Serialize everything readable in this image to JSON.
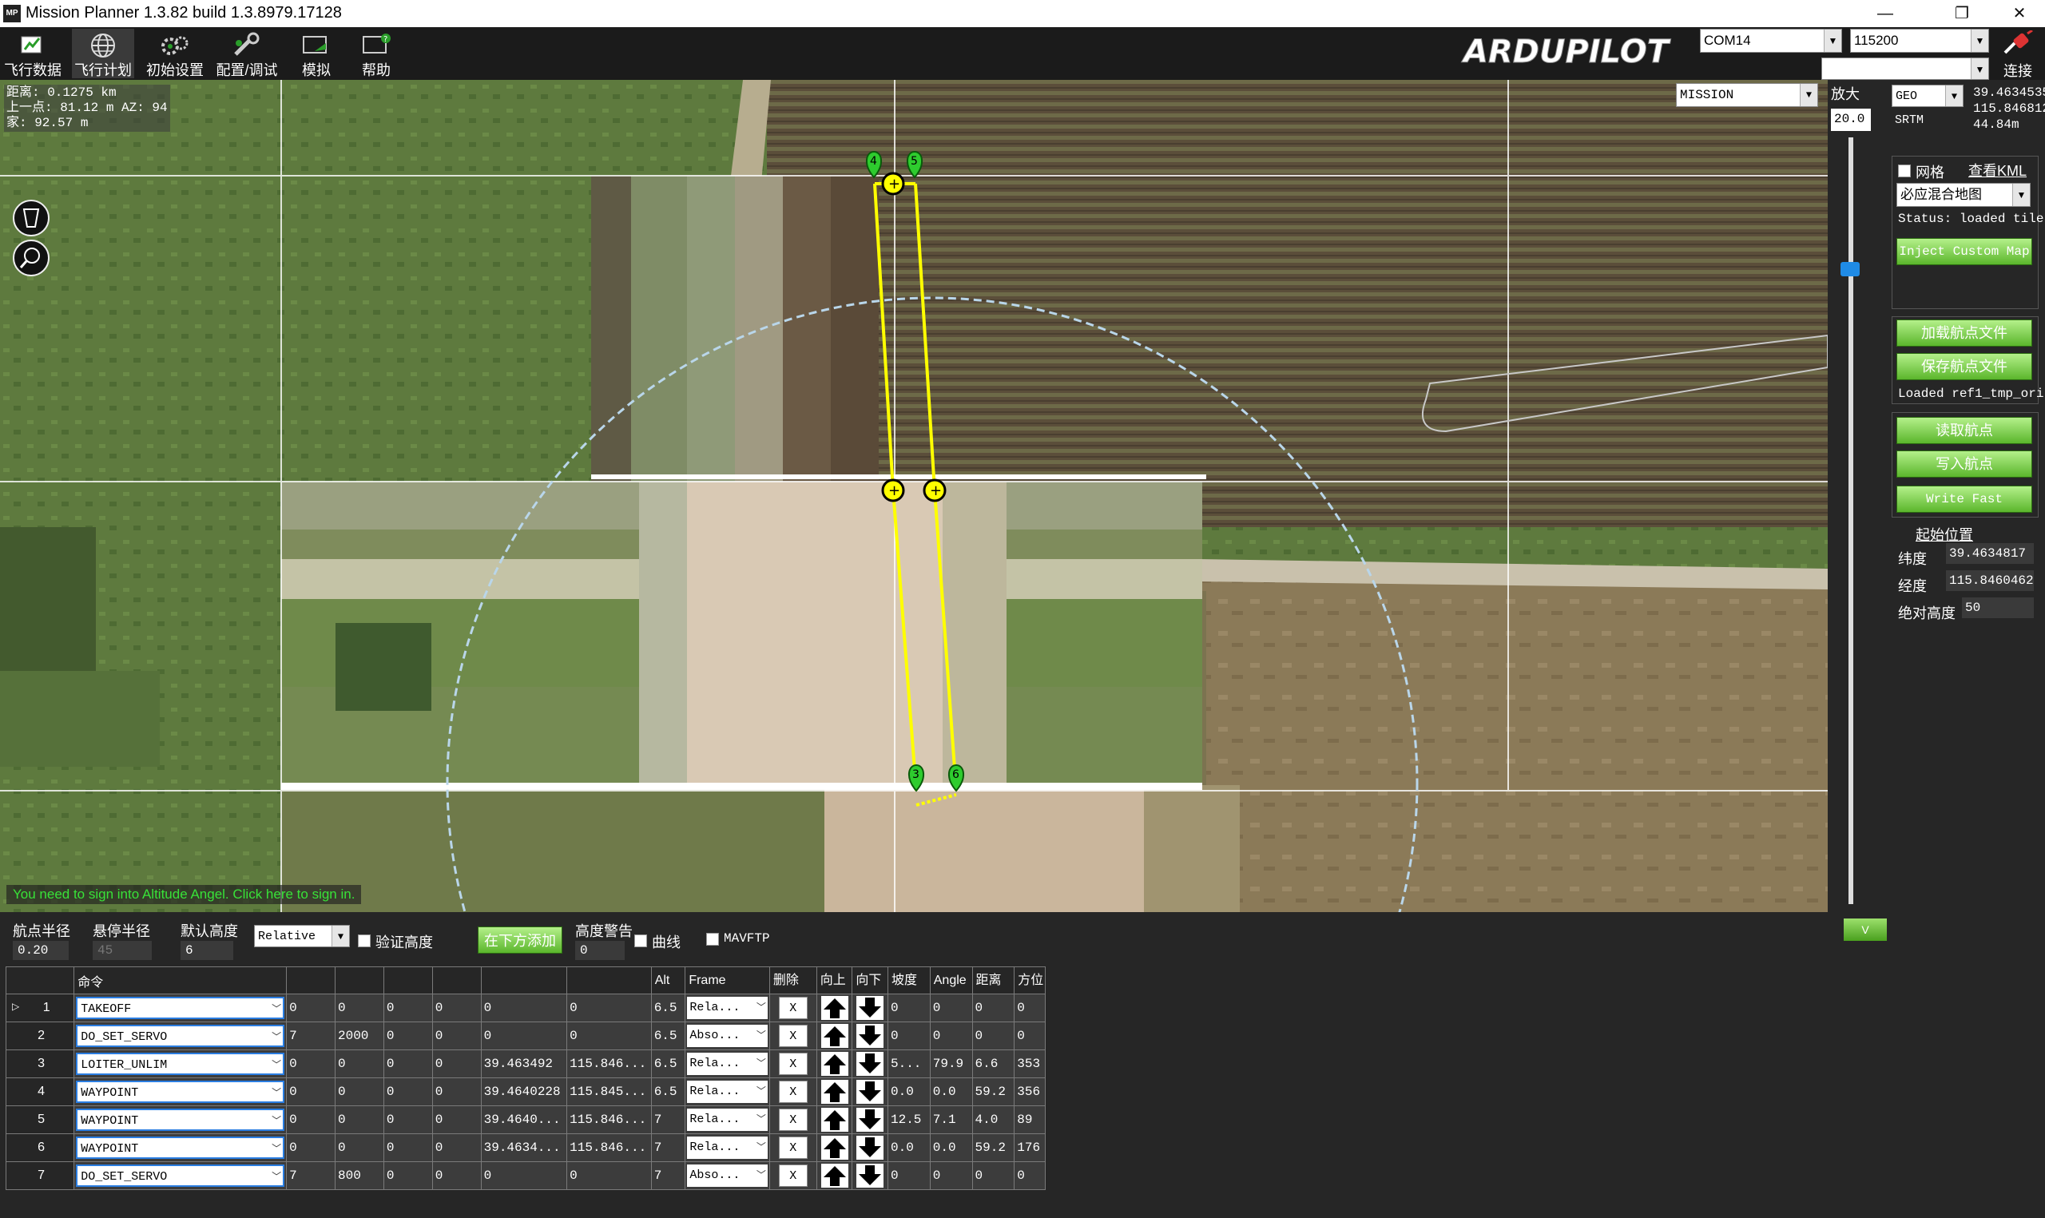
{
  "window": {
    "title": "Mission Planner 1.3.82 build 1.3.8979.17128",
    "app_icon": "MP",
    "minimize": "—",
    "restore": "❐",
    "close": "✕"
  },
  "toolbar": {
    "items": [
      {
        "label": "飞行数据",
        "icon": "flight-data-icon"
      },
      {
        "label": "飞行计划",
        "icon": "globe-icon"
      },
      {
        "label": "初始设置",
        "icon": "gears-icon"
      },
      {
        "label": "配置/调试",
        "icon": "wrench-icon"
      },
      {
        "label": "模拟",
        "icon": "simulation-icon"
      },
      {
        "label": "帮助",
        "icon": "help-icon"
      }
    ],
    "logo_text": "ARDUPILOT",
    "com_port": "COM14",
    "baud_rate": "115200",
    "connect_label": "连接"
  },
  "map": {
    "distance": "距离: 0.1275 km",
    "prev_point": "上一点: 81.12 m AZ: 94",
    "home": "家: 92.57 m",
    "mission_mode": "MISSION",
    "altitude_angel_msg": "You need to sign into Altitude Angel. Click here to sign in.",
    "markers": [
      "3",
      "4",
      "5",
      "6"
    ]
  },
  "right_panel": {
    "zoom_label": "放大",
    "zoom_value": "20.0",
    "geo_mode": "GEO",
    "coord_lat": "39.4634535",
    "coord_lng": "115.846812",
    "coord_alt": "44.84m",
    "srtm": "SRTM",
    "grid_label": "网格",
    "view_kml": "查看KML",
    "map_type": "必应混合地图",
    "status": "Status: loaded tile",
    "inject_custom_map": "Inject Custom Map",
    "load_wp_file": "加载航点文件",
    "save_wp_file": "保存航点文件",
    "loaded_file": "Loaded ref1_tmp_ori",
    "read_wp": "读取航点",
    "write_wp": "写入航点",
    "write_fast": "Write Fast",
    "home_location": "起始位置",
    "lat_label": "纬度",
    "lat_value": "39.4634817",
    "lng_label": "经度",
    "lng_value": "115.8460462",
    "abs_alt_label": "绝对高度",
    "abs_alt_value": "50",
    "collapse": "V"
  },
  "bottom": {
    "wp_radius_label": "航点半径",
    "wp_radius_value": "0.20",
    "loiter_radius_label": "悬停半径",
    "loiter_radius_value": "45",
    "default_alt_label": "默认高度",
    "default_alt_value": "6",
    "alt_frame": "Relative",
    "verify_height": "验证高度",
    "add_below": "在下方添加",
    "alt_warn_label": "高度警告",
    "alt_warn_value": "0",
    "spline": "曲线",
    "mavftp": "MAVFTP"
  },
  "table": {
    "headers": [
      "",
      "命令",
      "",
      "",
      "",
      "",
      "",
      "",
      "Alt",
      "Frame",
      "删除",
      "向上",
      "向下",
      "坡度",
      "Angle",
      "距离",
      "方位"
    ],
    "rows": [
      {
        "n": "1",
        "cmd": "TAKEOFF",
        "p1": "0",
        "p2": "0",
        "p3": "0",
        "p4": "0",
        "lat": "0",
        "lng": "0",
        "alt": "6.5",
        "frame": "Rela...",
        "grad": "0",
        "angle": "0",
        "dist": "0",
        "az": "0"
      },
      {
        "n": "2",
        "cmd": "DO_SET_SERVO",
        "p1": "7",
        "p2": "2000",
        "p3": "0",
        "p4": "0",
        "lat": "0",
        "lng": "0",
        "alt": "6.5",
        "frame": "Abso...",
        "grad": "0",
        "angle": "0",
        "dist": "0",
        "az": "0"
      },
      {
        "n": "3",
        "cmd": "LOITER_UNLIM",
        "p1": "0",
        "p2": "0",
        "p3": "0",
        "p4": "0",
        "lat": "39.463492",
        "lng": "115.846...",
        "alt": "6.5",
        "frame": "Rela...",
        "grad": "5...",
        "angle": "79.9",
        "dist": "6.6",
        "az": "353"
      },
      {
        "n": "4",
        "cmd": "WAYPOINT",
        "p1": "0",
        "p2": "0",
        "p3": "0",
        "p4": "0",
        "lat": "39.4640228",
        "lng": "115.845...",
        "alt": "6.5",
        "frame": "Rela...",
        "grad": "0.0",
        "angle": "0.0",
        "dist": "59.2",
        "az": "356"
      },
      {
        "n": "5",
        "cmd": "WAYPOINT",
        "p1": "0",
        "p2": "0",
        "p3": "0",
        "p4": "0",
        "lat": "39.4640...",
        "lng": "115.846...",
        "alt": "7",
        "frame": "Rela...",
        "grad": "12.5",
        "angle": "7.1",
        "dist": "4.0",
        "az": "89"
      },
      {
        "n": "6",
        "cmd": "WAYPOINT",
        "p1": "0",
        "p2": "0",
        "p3": "0",
        "p4": "0",
        "lat": "39.4634...",
        "lng": "115.846...",
        "alt": "7",
        "frame": "Rela...",
        "grad": "0.0",
        "angle": "0.0",
        "dist": "59.2",
        "az": "176"
      },
      {
        "n": "7",
        "cmd": "DO_SET_SERVO",
        "p1": "7",
        "p2": "800",
        "p3": "0",
        "p4": "0",
        "lat": "0",
        "lng": "0",
        "alt": "7",
        "frame": "Abso...",
        "grad": "0",
        "angle": "0",
        "dist": "0",
        "az": "0"
      }
    ],
    "delete_label": "X"
  },
  "colors": {
    "route": "#ffff00",
    "marker": "#2ecc2e",
    "button_green": "#6ccb3b",
    "panel_bg": "#262626"
  }
}
